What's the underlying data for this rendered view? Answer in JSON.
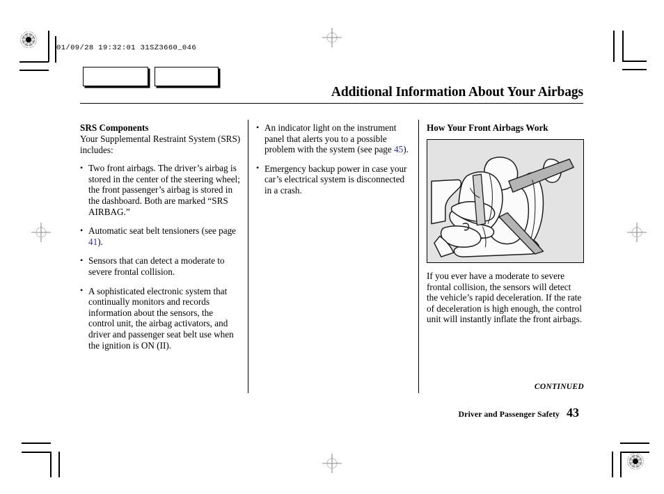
{
  "document": {
    "slug": "01/09/28 19:32:01 31SZ3660_046",
    "title": "Additional Information About Your Airbags"
  },
  "tabs": [
    {
      "label": ""
    },
    {
      "label": ""
    }
  ],
  "columns": {
    "left": {
      "heading": "SRS Components",
      "intro": "Your Supplemental Restraint System (SRS) includes:",
      "bullets": [
        {
          "text": "Two front airbags. The driver’s airbag is stored in the center of the steering wheel; the front passenger’s airbag is stored in the dashboard. Both are marked “SRS AIRBAG.”"
        },
        {
          "pre": "Automatic seat belt tensioners (see page ",
          "xref": "41",
          "post": ")."
        },
        {
          "text": "Sensors that can detect a moderate to severe frontal collision."
        },
        {
          "text": "A sophisticated electronic system that continually monitors and records information about the sensors, the control unit, the airbag activators, and driver and passenger seat belt use when the ignition is ON (II)."
        }
      ]
    },
    "middle": {
      "bullets": [
        {
          "pre": "An indicator light on the instrument panel that alerts you to a possible problem with the system (see page ",
          "xref": "45",
          "post": ")."
        },
        {
          "text": "Emergency backup power in case your car’s electrical system is disconnected in a crash."
        }
      ]
    },
    "right": {
      "heading": "How Your Front Airbags Work",
      "figure_name": "front-airbag-deployment-illustration",
      "caption": "If you ever have a moderate to severe frontal collision, the sensors will detect the vehicle’s rapid deceleration. If the rate of deceleration is high enough, the control unit will instantly inflate the front airbags."
    }
  },
  "footer": {
    "continued": "CONTINUED",
    "section": "Driver and Passenger Safety",
    "page_number": "43"
  },
  "colors": {
    "text": "#000000",
    "cross_reference": "#2a2ad0",
    "figure_background": "#e3e3e3",
    "page_background": "#ffffff"
  }
}
